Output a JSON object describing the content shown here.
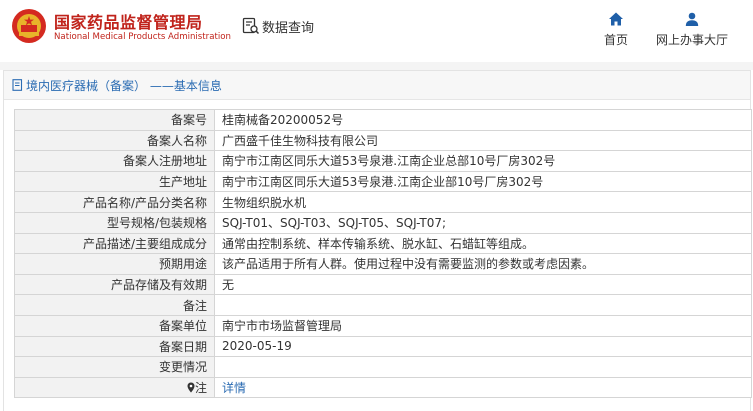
{
  "header": {
    "brand_cn": "国家药品监督管理局",
    "brand_en": "National Medical Products Administration",
    "search_label": "数据查询",
    "nav": [
      {
        "label": "首页",
        "icon": "home-icon"
      },
      {
        "label": "网上办事大厅",
        "icon": "user-icon"
      }
    ]
  },
  "breadcrumb": "境内医疗器械（备案） ——基本信息",
  "colors": {
    "brand_red": "#c0231b",
    "link_blue": "#2b6cb3",
    "nav_blue": "#1f5fa8"
  },
  "rows": [
    {
      "key": "备案号",
      "value": "桂南械备20200052号"
    },
    {
      "key": "备案人名称",
      "value": "广西盛千佳生物科技有限公司"
    },
    {
      "key": "备案人注册地址",
      "value": "南宁市江南区同乐大道53号泉港.江南企业总部10号厂房302号"
    },
    {
      "key": "生产地址",
      "value": "南宁市江南区同乐大道53号泉港.江南企业部10号厂房302号"
    },
    {
      "key": "产品名称/产品分类名称",
      "value": "生物组织脱水机"
    },
    {
      "key": "型号规格/包装规格",
      "value": "SQJ-T01、SQJ-T03、SQJ-T05、SQJ-T07;"
    },
    {
      "key": "产品描述/主要组成成分",
      "value": "通常由控制系统、样本传输系统、脱水缸、石蜡缸等组成。"
    },
    {
      "key": "预期用途",
      "value": "该产品适用于所有人群。使用过程中没有需要监测的参数或考虑因素。"
    },
    {
      "key": "产品存储及有效期",
      "value": "无"
    },
    {
      "key": "备注",
      "value": ""
    },
    {
      "key": "备案单位",
      "value": "南宁市市场监督管理局"
    },
    {
      "key": "备案日期",
      "value": "2020-05-19"
    },
    {
      "key": "变更情况",
      "value": ""
    },
    {
      "key": "注",
      "value": "详情"
    }
  ]
}
